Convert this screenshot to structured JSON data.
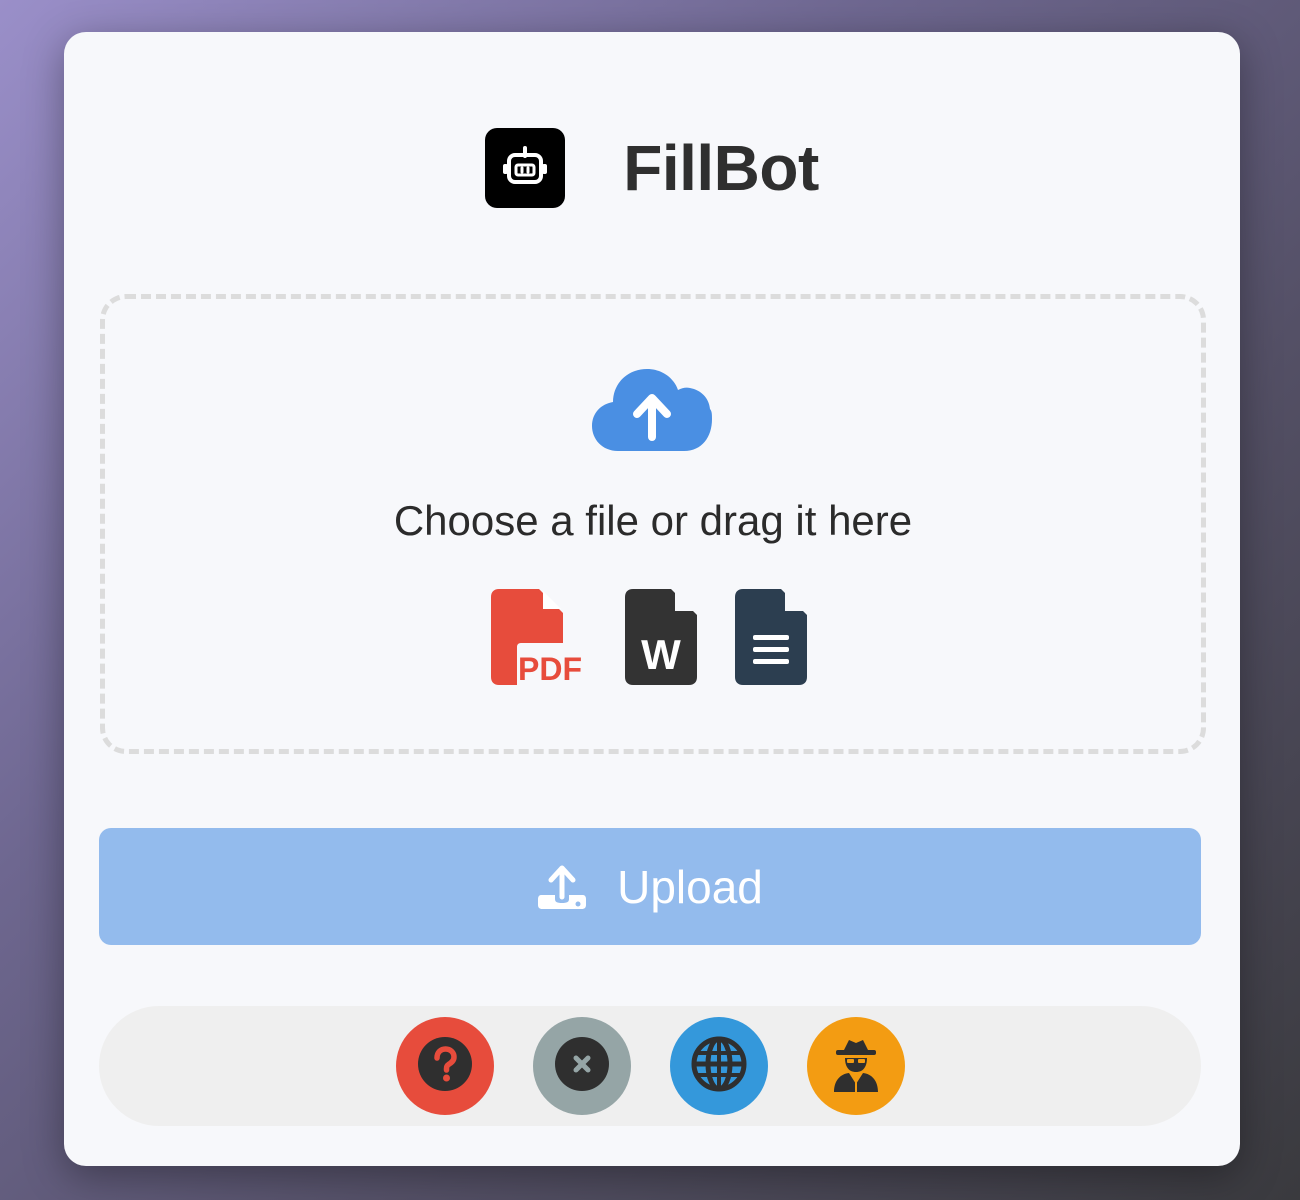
{
  "app": {
    "title": "FillBot",
    "logo_icon": "robot-icon"
  },
  "dropzone": {
    "icon": "cloud-upload-icon",
    "text": "Choose a file or drag it here",
    "file_types": [
      {
        "name": "pdf",
        "label": "PDF",
        "icon": "pdf-file-icon",
        "color": "#e74c3c"
      },
      {
        "name": "word",
        "label": "W",
        "icon": "word-file-icon",
        "color": "#333333"
      },
      {
        "name": "text",
        "icon": "text-file-icon",
        "color": "#2c3e50"
      }
    ]
  },
  "upload_button": {
    "label": "Upload",
    "icon": "upload-icon",
    "color": "#93bbed"
  },
  "toolbar": {
    "buttons": [
      {
        "name": "help",
        "icon": "question-icon",
        "color": "#e74c3c"
      },
      {
        "name": "close",
        "icon": "close-icon",
        "color": "#95a5a6"
      },
      {
        "name": "language",
        "icon": "globe-icon",
        "color": "#3498db"
      },
      {
        "name": "incognito",
        "icon": "spy-icon",
        "color": "#f39c12"
      }
    ]
  },
  "colors": {
    "accent": "#4a90e2",
    "card_background": "#f7f8fb"
  }
}
